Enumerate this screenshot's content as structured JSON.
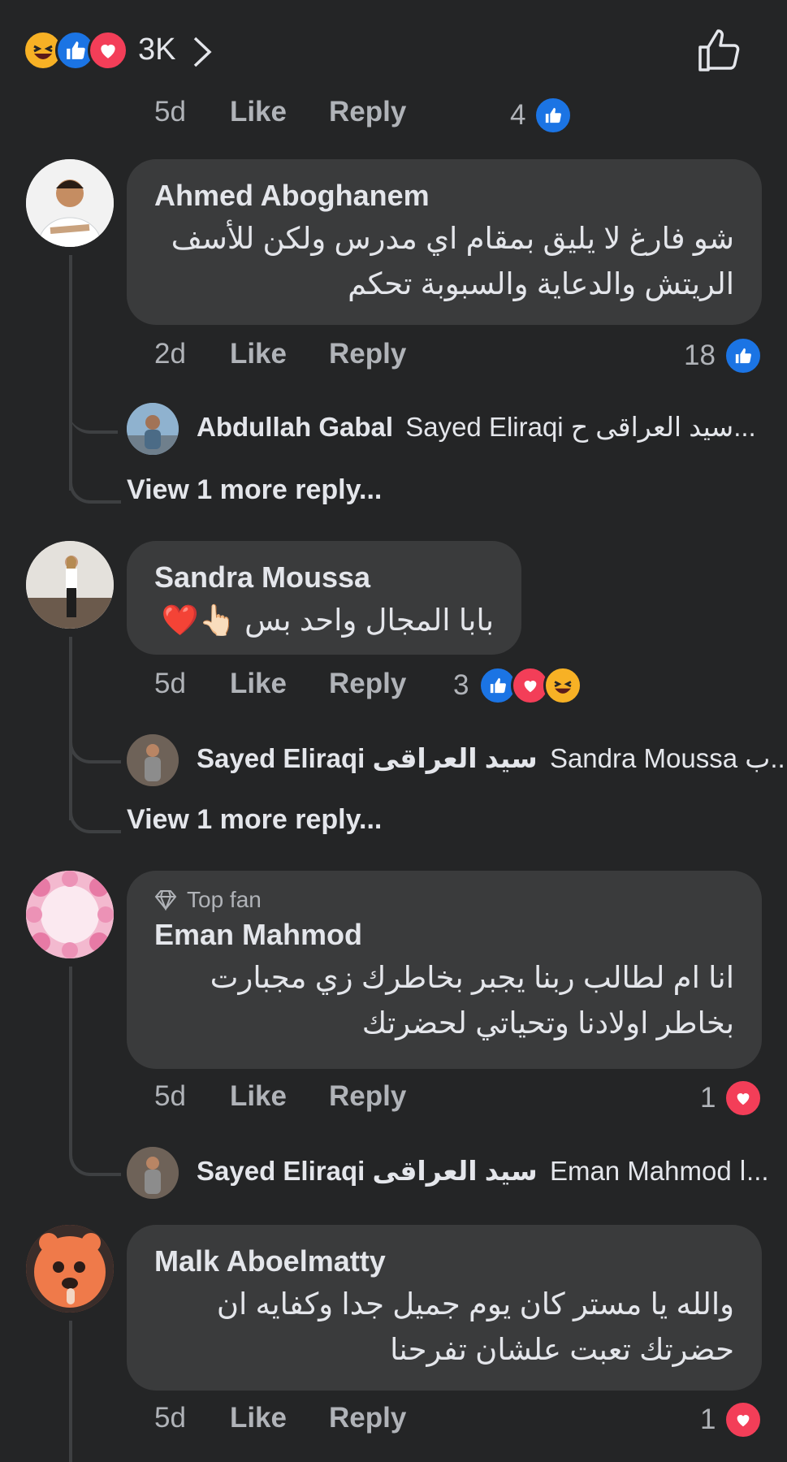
{
  "header": {
    "reaction_count": "3K",
    "reactions": [
      "haha-icon",
      "like-icon",
      "love-icon"
    ]
  },
  "top_meta": {
    "time": "5d",
    "like": "Like",
    "reply": "Reply",
    "count": "4"
  },
  "comments": [
    {
      "name": "Ahmed Aboghanem",
      "lines": [
        "شو فارغ لا يليق بمقام اي مدرس ولكن للأسف",
        "الريتش والدعاية والسبوبة تحكم"
      ],
      "time": "2d",
      "like": "Like",
      "reply": "Reply",
      "count": "18",
      "reply_preview": {
        "author": "Abdullah Gabal",
        "text": "Sayed Eliraqi سيد العراقى ح..."
      },
      "view_more": "View 1 more reply..."
    },
    {
      "name": "Sandra Moussa",
      "lines": [
        "بابا المجال واحد بس 👆🏻❤️"
      ],
      "time": "5d",
      "like": "Like",
      "reply": "Reply",
      "count": "3",
      "reply_preview": {
        "author": "Sayed Eliraqi سيد العراقى",
        "text": "Sandra Moussa ب..."
      },
      "view_more": "View 1 more reply..."
    },
    {
      "badge": "Top fan",
      "name": "Eman Mahmod",
      "lines": [
        "انا ام لطالب ربنا يجبر بخاطرك زي مجبارت",
        "بخاطر اولادنا وتحياتي لحضرتك"
      ],
      "time": "5d",
      "like": "Like",
      "reply": "Reply",
      "count": "1",
      "reply_preview": {
        "author": "Sayed Eliraqi سيد العراقى",
        "text": "Eman Mahmod ا..."
      }
    },
    {
      "name": "Malk Aboelmatty",
      "lines": [
        "والله يا مستر كان يوم جميل جدا وكفايه ان",
        "حضرتك تعبت علشان تفرحنا"
      ],
      "time": "5d",
      "like": "Like",
      "reply": "Reply",
      "count": "1"
    }
  ],
  "colors": {
    "background": "#242526",
    "bubble": "#3a3b3c",
    "like": "#1b74e4",
    "love": "#f33e58",
    "haha": "#f7b125",
    "muted": "#b0b3b8"
  }
}
